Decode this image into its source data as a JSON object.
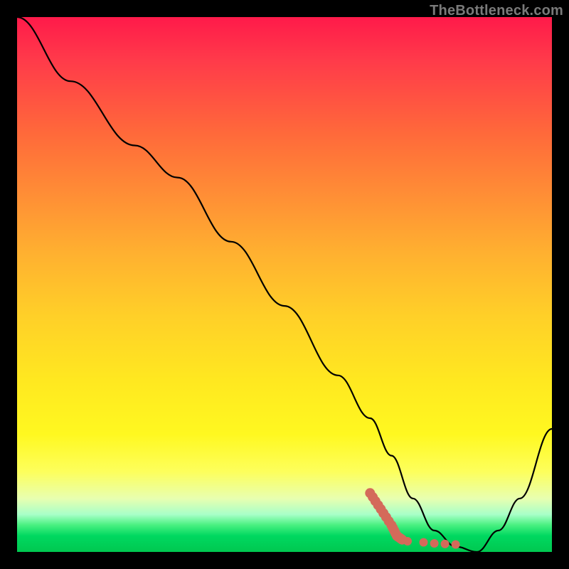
{
  "watermark": "TheBottleneck.com",
  "colors": {
    "frame": "#000000",
    "curve": "#000000",
    "marker": "#d46a5a",
    "text": "#7a7a7a"
  },
  "chart_data": {
    "type": "line",
    "title": "",
    "xlabel": "",
    "ylabel": "",
    "xlim": [
      0,
      100
    ],
    "ylim": [
      0,
      100
    ],
    "grid": false,
    "series": [
      {
        "name": "bottleneck-curve",
        "x": [
          0,
          10,
          22,
          30,
          40,
          50,
          60,
          66,
          70,
          74,
          78,
          82,
          86,
          90,
          94,
          100
        ],
        "y": [
          100,
          88,
          76,
          70,
          58,
          46,
          33,
          25,
          18,
          10,
          4,
          1,
          0,
          4,
          10,
          23
        ]
      }
    ],
    "annotations": [
      {
        "name": "optimal-region",
        "type": "marker-path",
        "x": [
          66,
          68,
          70,
          71,
          72,
          73,
          76,
          78,
          80,
          82
        ],
        "y": [
          11,
          8,
          5,
          3,
          2.3,
          2.0,
          1.8,
          1.6,
          1.5,
          1.4
        ]
      }
    ]
  }
}
